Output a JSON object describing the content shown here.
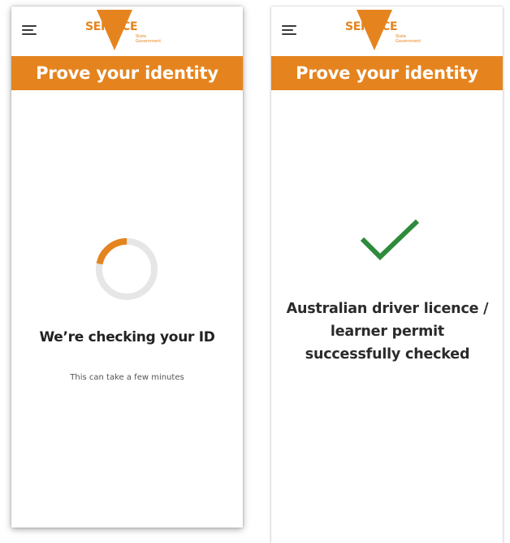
{
  "colors": {
    "brand_orange": "#e5841f",
    "success_green": "#2e8b3c",
    "spinner_track": "#e6e6e6"
  },
  "screens": [
    {
      "menu_icon": "hamburger-menu-icon",
      "logo": {
        "word": "SERVICE",
        "sub_line1": "State",
        "sub_line2": "Government"
      },
      "banner_title": "Prove your identity",
      "spinner_progress": 0.22,
      "status_title": "We’re checking your ID",
      "status_subtitle": "This can take a few minutes"
    },
    {
      "menu_icon": "hamburger-menu-icon",
      "logo": {
        "word": "SERVICE",
        "sub_line1": "State",
        "sub_line2": "Government"
      },
      "banner_title": "Prove your identity",
      "success_icon": "checkmark-icon",
      "success_message": "Australian driver licence / learner permit successfully checked"
    }
  ]
}
